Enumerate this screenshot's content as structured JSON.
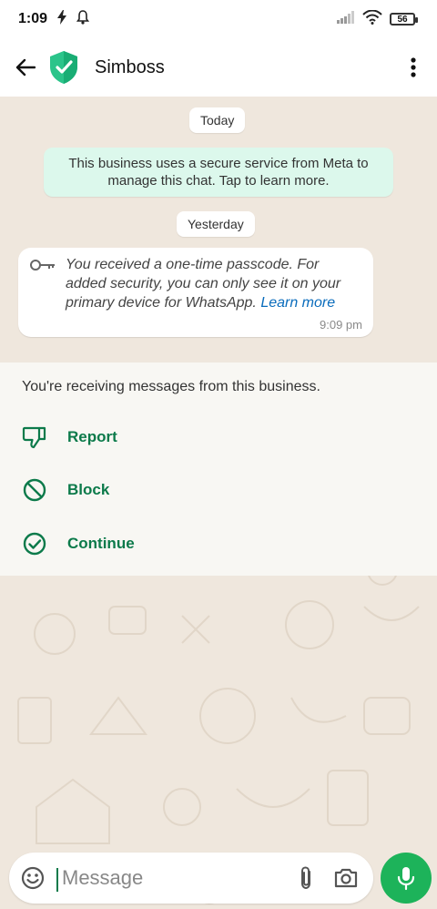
{
  "status_bar": {
    "time": "1:09",
    "battery": "56"
  },
  "header": {
    "contact_name": "Simboss"
  },
  "chat": {
    "date_today": "Today",
    "system_notice": "This business uses a secure service from Meta to manage this chat. Tap to learn more.",
    "date_yesterday": "Yesterday",
    "message": {
      "text": "You received a one-time passcode. For added security, you can only see it on your primary device for WhatsApp.",
      "link_text": "Learn more",
      "time": "9:09 pm"
    }
  },
  "business_panel": {
    "info": "You're receiving messages from this business.",
    "actions": [
      {
        "label": "Report",
        "icon": "thumb-down-icon"
      },
      {
        "label": "Block",
        "icon": "block-icon"
      },
      {
        "label": "Continue",
        "icon": "check-circle-icon"
      }
    ]
  },
  "composer": {
    "placeholder": "Message"
  },
  "colors": {
    "accent": "#0c7a4a",
    "mic_button": "#1db35a",
    "notice_bg": "#dcf8ec",
    "chat_bg": "#efe7dd"
  }
}
